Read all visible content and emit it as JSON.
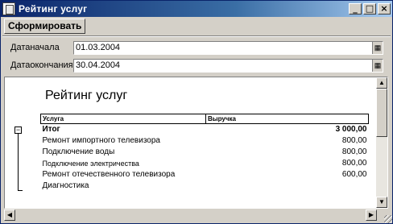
{
  "window": {
    "title": "Рейтинг услуг"
  },
  "toolbar": {
    "generate_label": "Сформировать"
  },
  "form": {
    "date_start_label": "Датаначала",
    "date_start_value": "01.03.2004",
    "date_end_label": "Датаокончания",
    "date_end_value": "30.04.2004"
  },
  "report": {
    "title": "Рейтинг услуг",
    "columns": [
      "Услуга",
      "Выручка"
    ],
    "total_label": "Итог",
    "total_value": "3 000,00",
    "rows": [
      {
        "name": "Ремонт импортного телевизора",
        "value": "800,00"
      },
      {
        "name": "Подключение воды",
        "value": "800,00"
      },
      {
        "name": "Подключение электричества",
        "value": "800,00"
      },
      {
        "name": "Ремонт отечественного телевизора",
        "value": "600,00"
      },
      {
        "name": "Диагностика",
        "value": ""
      }
    ]
  },
  "icons": {
    "calendar": "calendar-icon",
    "minimize": "minimize-icon",
    "maximize": "maximize-icon",
    "close": "close-icon"
  }
}
